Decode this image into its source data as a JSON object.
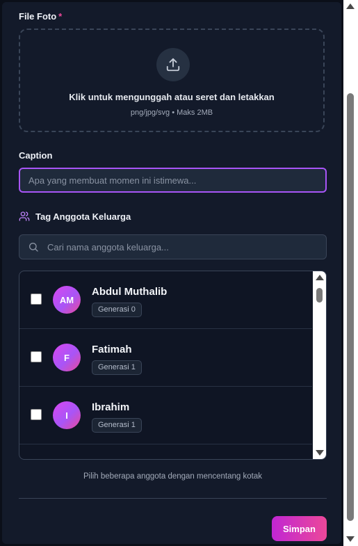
{
  "form": {
    "file_label": "File Foto",
    "required_mark": "*",
    "dropzone": {
      "title": "Klik untuk mengunggah atau seret dan letakkan",
      "subtitle": "png/jpg/svg • Maks 2MB",
      "icon": "upload-icon"
    },
    "caption_label": "Caption",
    "caption_placeholder": "Apa yang membuat momen ini istimewa...",
    "caption_value": "",
    "tag_label": "Tag Anggota Keluarga",
    "tag_icon": "users-icon",
    "search_placeholder": "Cari nama anggota keluarga...",
    "members": [
      {
        "initials": "AM",
        "name": "Abdul Muthalib",
        "generation": "Generasi 0",
        "checked": false
      },
      {
        "initials": "F",
        "name": "Fatimah",
        "generation": "Generasi 1",
        "checked": false
      },
      {
        "initials": "I",
        "name": "Ibrahim",
        "generation": "Generasi 1",
        "checked": false
      }
    ],
    "hint": "Pilih beberapa anggota dengan mencentang kotak",
    "save_label": "Simpan"
  },
  "colors": {
    "background": "#131a2a",
    "accent": "#a855f7",
    "accent_pink": "#ec4899",
    "required": "#ec4899"
  }
}
